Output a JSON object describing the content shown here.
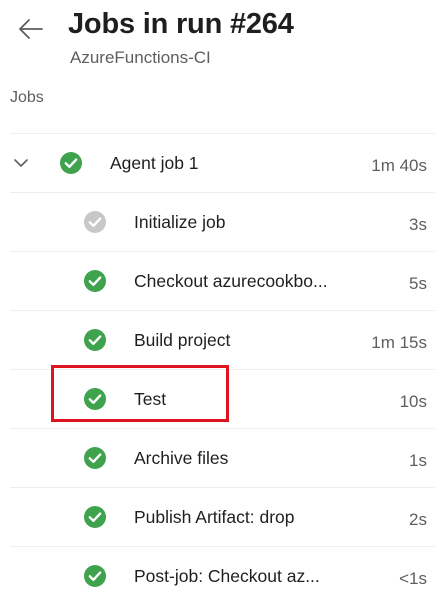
{
  "header": {
    "title": "Jobs in run #264",
    "subtitle": "AzureFunctions-CI",
    "back_icon": "arrow-left-icon"
  },
  "section": {
    "label": "Jobs"
  },
  "colors": {
    "success": "#3fa34d",
    "skipped": "#c8c8c8",
    "highlight": "#e0141e"
  },
  "jobs": [
    {
      "label": "Agent job 1",
      "duration": "1m 40s",
      "status": "succeeded",
      "level": "parent",
      "expanded": true
    },
    {
      "label": "Initialize job",
      "duration": "3s",
      "status": "skipped",
      "level": "child"
    },
    {
      "label": "Checkout azurecookbo...",
      "duration": "5s",
      "status": "succeeded",
      "level": "child"
    },
    {
      "label": "Build project",
      "duration": "1m 15s",
      "status": "succeeded",
      "level": "child"
    },
    {
      "label": "Test",
      "duration": "10s",
      "status": "succeeded",
      "level": "child",
      "highlighted": true
    },
    {
      "label": "Archive files",
      "duration": "1s",
      "status": "succeeded",
      "level": "child"
    },
    {
      "label": "Publish Artifact: drop",
      "duration": "2s",
      "status": "succeeded",
      "level": "child"
    },
    {
      "label": "Post-job: Checkout az...",
      "duration": "<1s",
      "status": "succeeded",
      "level": "child"
    }
  ]
}
